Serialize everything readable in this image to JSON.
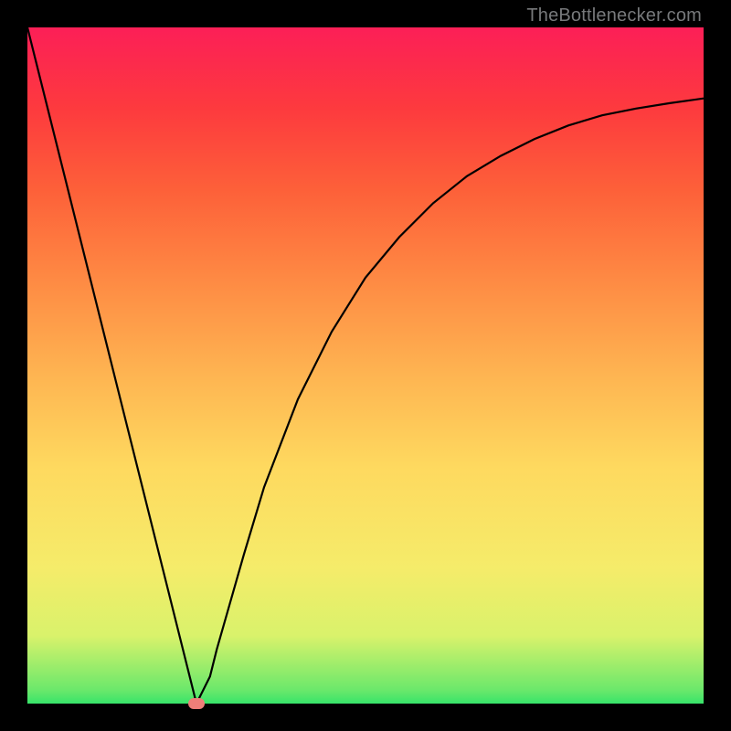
{
  "watermark": "TheBottlenecker.com",
  "chart_data": {
    "type": "line",
    "title": "",
    "xlabel": "",
    "ylabel": "",
    "xlim": [
      0,
      100
    ],
    "ylim": [
      0,
      100
    ],
    "grid": false,
    "series": [
      {
        "name": "curve",
        "x": [
          0,
          5,
          10,
          15,
          20,
          22.5,
          25,
          27,
          28,
          30,
          32,
          35,
          40,
          45,
          50,
          55,
          60,
          65,
          70,
          75,
          80,
          85,
          90,
          95,
          100
        ],
        "values": [
          100,
          80,
          60,
          40,
          20,
          10,
          0,
          4,
          8,
          15,
          22,
          32,
          45,
          55,
          63,
          69,
          74,
          78,
          81,
          83.5,
          85.5,
          87,
          88,
          88.8,
          89.5
        ]
      }
    ],
    "marker": {
      "x": 25,
      "y": 0
    },
    "gradient_stops": [
      {
        "pct": 0,
        "color": "#37e46a"
      },
      {
        "pct": 2,
        "color": "#6be86b"
      },
      {
        "pct": 10,
        "color": "#d9f26b"
      },
      {
        "pct": 20,
        "color": "#f5ec6a"
      },
      {
        "pct": 35,
        "color": "#fed95f"
      },
      {
        "pct": 48,
        "color": "#feb652"
      },
      {
        "pct": 62,
        "color": "#fe8c44"
      },
      {
        "pct": 76,
        "color": "#fd6039"
      },
      {
        "pct": 88,
        "color": "#fd3a3e"
      },
      {
        "pct": 100,
        "color": "#fc1f57"
      }
    ]
  }
}
